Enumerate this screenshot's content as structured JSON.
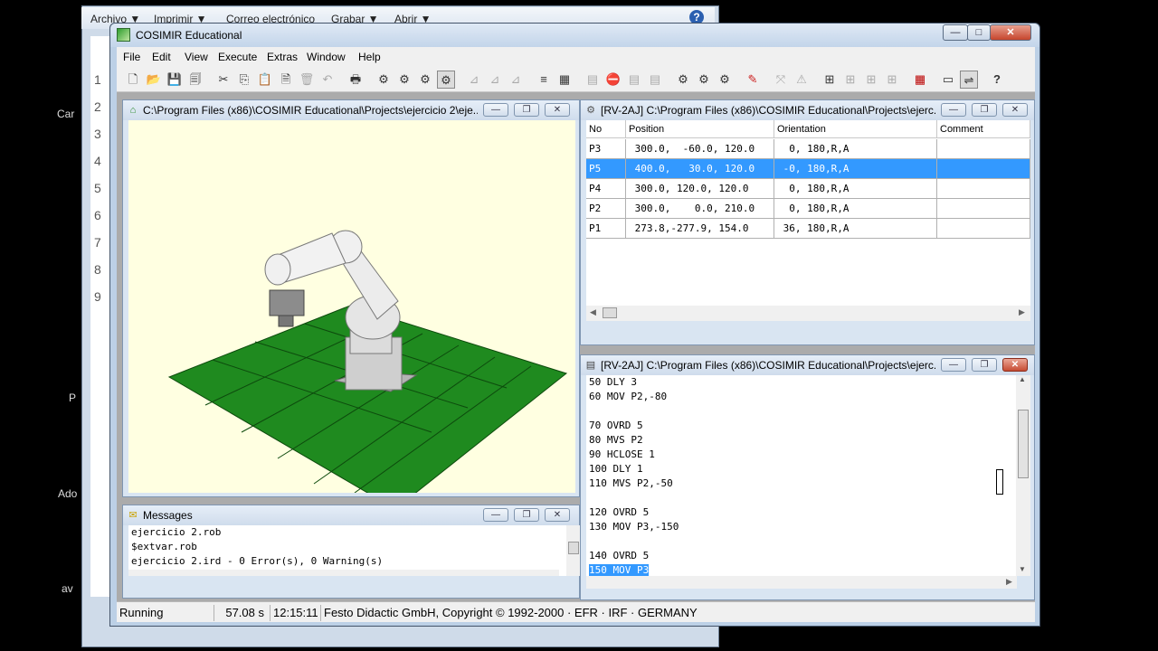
{
  "background_window": {
    "menu": [
      "Archivo ▼",
      "Imprimir ▼",
      "Correo electrónico",
      "Grabar ▼",
      "Abrir ▼"
    ],
    "side_labels": [
      "Car",
      "P",
      "Ado",
      "av"
    ]
  },
  "app": {
    "title": "COSIMIR Educational",
    "menu": [
      "File",
      "Edit",
      "View",
      "Execute",
      "Extras",
      "Window",
      "Help"
    ]
  },
  "view3d_window": {
    "title": "C:\\Program Files (x86)\\COSIMIR Educational\\Projects\\ejercicio 2\\eje..."
  },
  "messages_window": {
    "title": "Messages",
    "lines": [
      "ejercicio 2.rob",
      "$extvar.rob",
      "ejercicio 2.ird - 0 Error(s), 0 Warning(s)"
    ]
  },
  "positions_window": {
    "title": "[RV-2AJ] C:\\Program Files (x86)\\COSIMIR Educational\\Projects\\ejerc...",
    "headers": [
      "No",
      "Position",
      "Orientation",
      "Comment"
    ],
    "rows": [
      {
        "no": "P3",
        "position": " 300.0,  -60.0, 120.0",
        "orientation": "  0, 180,R,A",
        "comment": "",
        "selected": false
      },
      {
        "no": "P5",
        "position": " 400.0,   30.0, 120.0",
        "orientation": " -0, 180,R,A",
        "comment": "",
        "selected": true
      },
      {
        "no": "P4",
        "position": " 300.0, 120.0, 120.0",
        "orientation": "  0, 180,R,A",
        "comment": "",
        "selected": false
      },
      {
        "no": "P2",
        "position": " 300.0,    0.0, 210.0",
        "orientation": "  0, 180,R,A",
        "comment": "",
        "selected": false
      },
      {
        "no": "P1",
        "position": " 273.8,-277.9, 154.0",
        "orientation": " 36, 180,R,A",
        "comment": "",
        "selected": false
      }
    ]
  },
  "program_window": {
    "title": "[RV-2AJ] C:\\Program Files (x86)\\COSIMIR Educational\\Projects\\ejerc...",
    "lines": [
      "50 DLY 3",
      "60 MOV P2,-80",
      "",
      "70 OVRD 5",
      "80 MVS P2",
      "90 HCLOSE 1",
      "100 DLY 1",
      "110 MVS P2,-50",
      "",
      "120 OVRD 5",
      "130 MOV P3,-150",
      "",
      "140 OVRD 5",
      "150 MOV P3"
    ],
    "selected_line": "150 MOV P3"
  },
  "status": {
    "state": "Running",
    "elapsed": "57.08 s",
    "clock": "12:15:11",
    "copyright": "Festo Didactic GmbH, Copyright © 1992-2000 · EFR · IRF · GERMANY"
  },
  "colors": {
    "floor": "#1f8a1f",
    "view_bg": "#ffffe1",
    "selection": "#3399ff"
  }
}
